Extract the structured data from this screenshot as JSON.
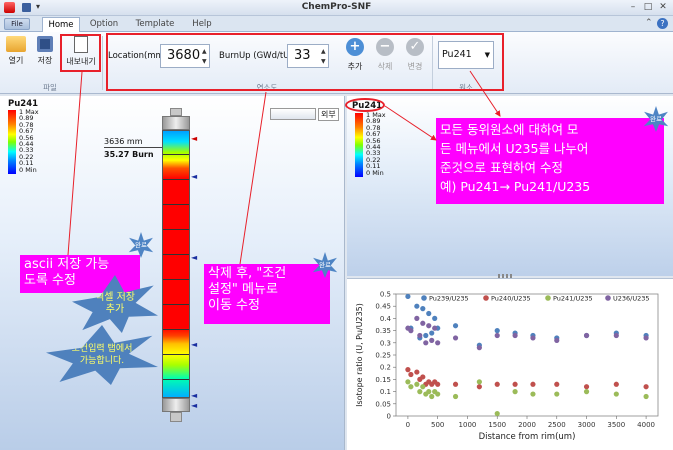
{
  "window": {
    "title": "ChemPro-SNF",
    "file_menu": "File"
  },
  "tabs": [
    "Home",
    "Option",
    "Template",
    "Help"
  ],
  "ribbon": {
    "open": "열기",
    "save": "저장",
    "export": "내보내기",
    "file_group": "파일",
    "location_label": "Location(mm)",
    "location_value": "3680",
    "burnup_label": "BurnUp (GWd/tU)",
    "burnup_value": "33",
    "add": "추가",
    "delete": "삭제",
    "change": "변경",
    "condition_group": "연소도",
    "nuclide_value": "Pu241",
    "nuclide_group": "원소"
  },
  "left": {
    "legend_title": "Pu241",
    "legend_ticks": [
      "1 Max",
      "0.89",
      "0.78",
      "0.67",
      "0.56",
      "0.44",
      "0.33",
      "0.22",
      "0.11",
      "0 Min"
    ],
    "toggle_label": "외부",
    "readout_mm": "3636 mm",
    "readout_burn": "35.27 Burn"
  },
  "right_top": {
    "legend_title": "Pu241",
    "legend_ticks": [
      "1 Max",
      "0.89",
      "0.78",
      "0.67",
      "0.56",
      "0.44",
      "0.33",
      "0.22",
      "0.11",
      "0 Min"
    ]
  },
  "annotations": {
    "note_ascii": "ascii 저장 가능\n도록 수정",
    "note_delete": "삭제 후, \"조건\n설정\" 메뉴로\n이동 수정",
    "note_ratio": "모든 동위원소에 대하여 모\n든 메뉴에서 U235를 나누어\n준것으로 표현하여 수정\n예) Pu241→ Pu241/U235",
    "badge_done": "완료",
    "star_excel": "엑셀 저장\n추가",
    "star_input": "조건입력 탭에서\n가능합니다."
  },
  "chart_data": {
    "type": "scatter",
    "xlabel": "Distance from rim(um)",
    "ylabel": "Isotope ratio (U, Pu/U235)",
    "xlim": [
      -200,
      4200
    ],
    "ylim": [
      0,
      0.5
    ],
    "xticks": [
      0,
      500,
      1000,
      1500,
      2000,
      2500,
      3000,
      3500,
      4000
    ],
    "yticks": [
      0,
      0.05,
      0.1,
      0.15,
      0.2,
      0.25,
      0.3,
      0.35,
      0.4,
      0.45,
      0.5
    ],
    "legend_position": "top",
    "series": [
      {
        "name": "Pu239/U235",
        "color": "#4f81bd",
        "x": [
          0,
          50,
          150,
          200,
          250,
          300,
          350,
          400,
          450,
          500,
          800,
          1200,
          1500,
          1800,
          2100,
          2500,
          3000,
          3500,
          4000
        ],
        "y": [
          0.49,
          0.36,
          0.45,
          0.32,
          0.44,
          0.33,
          0.42,
          0.34,
          0.4,
          0.36,
          0.37,
          0.29,
          0.35,
          0.34,
          0.33,
          0.32,
          0.33,
          0.34,
          0.33
        ]
      },
      {
        "name": "Pu240/U235",
        "color": "#c0504d",
        "x": [
          0,
          50,
          150,
          200,
          250,
          300,
          350,
          400,
          450,
          500,
          800,
          1200,
          1500,
          1800,
          2100,
          2500,
          3000,
          3500,
          4000
        ],
        "y": [
          0.19,
          0.17,
          0.18,
          0.15,
          0.16,
          0.13,
          0.14,
          0.13,
          0.14,
          0.13,
          0.13,
          0.12,
          0.13,
          0.13,
          0.13,
          0.13,
          0.12,
          0.13,
          0.12
        ]
      },
      {
        "name": "Pu241/U235",
        "color": "#9bbb59",
        "x": [
          0,
          50,
          150,
          200,
          250,
          300,
          350,
          400,
          450,
          500,
          800,
          1200,
          1500,
          1800,
          2100,
          2500,
          3000,
          3500,
          4000
        ],
        "y": [
          0.14,
          0.12,
          0.13,
          0.1,
          0.12,
          0.09,
          0.1,
          0.08,
          0.1,
          0.09,
          0.08,
          0.14,
          0.01,
          0.1,
          0.09,
          0.09,
          0.1,
          0.09,
          0.08
        ]
      },
      {
        "name": "U236/U235",
        "color": "#8064a2",
        "x": [
          0,
          50,
          150,
          200,
          250,
          300,
          350,
          400,
          450,
          500,
          800,
          1200,
          1500,
          1800,
          2100,
          2500,
          3000,
          3500,
          4000
        ],
        "y": [
          0.36,
          0.35,
          0.4,
          0.33,
          0.38,
          0.3,
          0.37,
          0.31,
          0.36,
          0.3,
          0.32,
          0.28,
          0.33,
          0.33,
          0.32,
          0.31,
          0.33,
          0.33,
          0.32
        ]
      }
    ]
  },
  "colors": {
    "annotation_red": "#e8202a",
    "note_magenta": "#ff00ff",
    "star_blue": "#4f81bd"
  }
}
